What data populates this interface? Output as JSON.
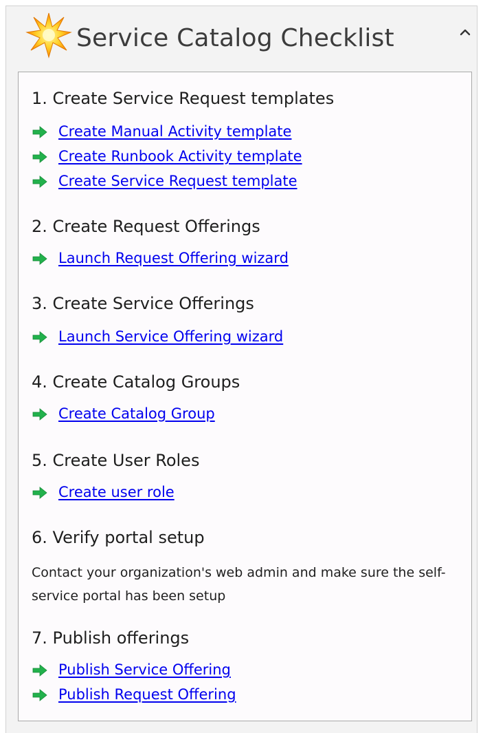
{
  "header": {
    "title": "Service Catalog Checklist",
    "icon": "star-icon",
    "collapse_icon": "chevron-up-icon"
  },
  "colors": {
    "pane_bg": "#f3f3f3",
    "box_bg": "#fdfbfd",
    "link": "#0000ee",
    "arrow": "#22b14c"
  },
  "steps": [
    {
      "heading": "1. Create Service Request templates",
      "links": [
        "Create Manual  Activity template",
        "Create Runbook Activity template",
        "Create Service Request template"
      ]
    },
    {
      "heading": "2. Create Request Offerings",
      "links": [
        "Launch Request Offering wizard"
      ]
    },
    {
      "heading": "3. Create Service Offerings",
      "links": [
        "Launch Service Offering wizard"
      ]
    },
    {
      "heading": "4. Create Catalog Groups",
      "links": [
        "Create Catalog Group"
      ]
    },
    {
      "heading": "5. Create User Roles",
      "links": [
        "Create user role"
      ]
    },
    {
      "heading": "6. Verify portal setup",
      "text": "Contact your organization's web admin and make sure the self-service portal has been setup"
    },
    {
      "heading": "7. Publish offerings",
      "links": [
        "Publish Service Offering",
        "Publish Request Offering"
      ]
    }
  ]
}
